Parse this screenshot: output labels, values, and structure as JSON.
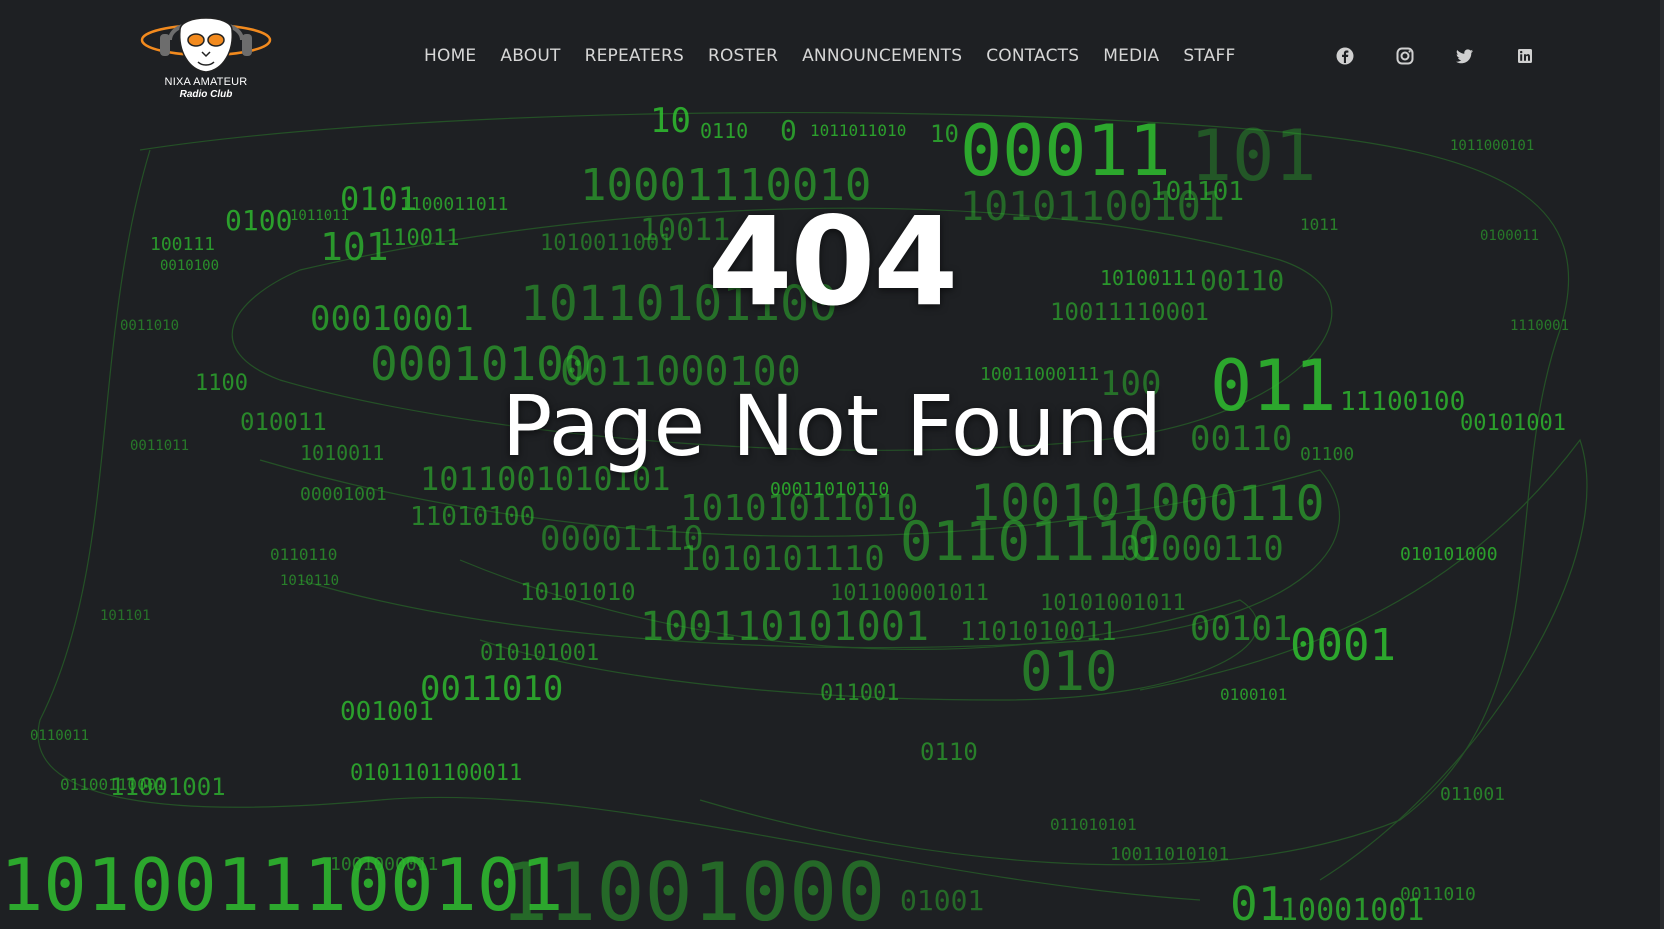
{
  "site": {
    "logo_line1": "NIXA AMATEUR",
    "logo_line2": "Radio Club"
  },
  "nav": {
    "items": [
      {
        "label": "HOME"
      },
      {
        "label": "ABOUT"
      },
      {
        "label": "REPEATERS"
      },
      {
        "label": "ROSTER"
      },
      {
        "label": "ANNOUNCEMENTS"
      },
      {
        "label": "CONTACTS"
      },
      {
        "label": "MEDIA"
      },
      {
        "label": "STAFF"
      }
    ]
  },
  "social": [
    {
      "icon": "facebook-icon"
    },
    {
      "icon": "instagram-icon"
    },
    {
      "icon": "twitter-icon"
    },
    {
      "icon": "linkedin-icon"
    }
  ],
  "error": {
    "code": "404",
    "message": "Page Not Found"
  },
  "colors": {
    "background": "#1e2023",
    "binary_green": "#2fbf2f",
    "text": "#ffffff",
    "logo_orange": "#f28a1e"
  }
}
